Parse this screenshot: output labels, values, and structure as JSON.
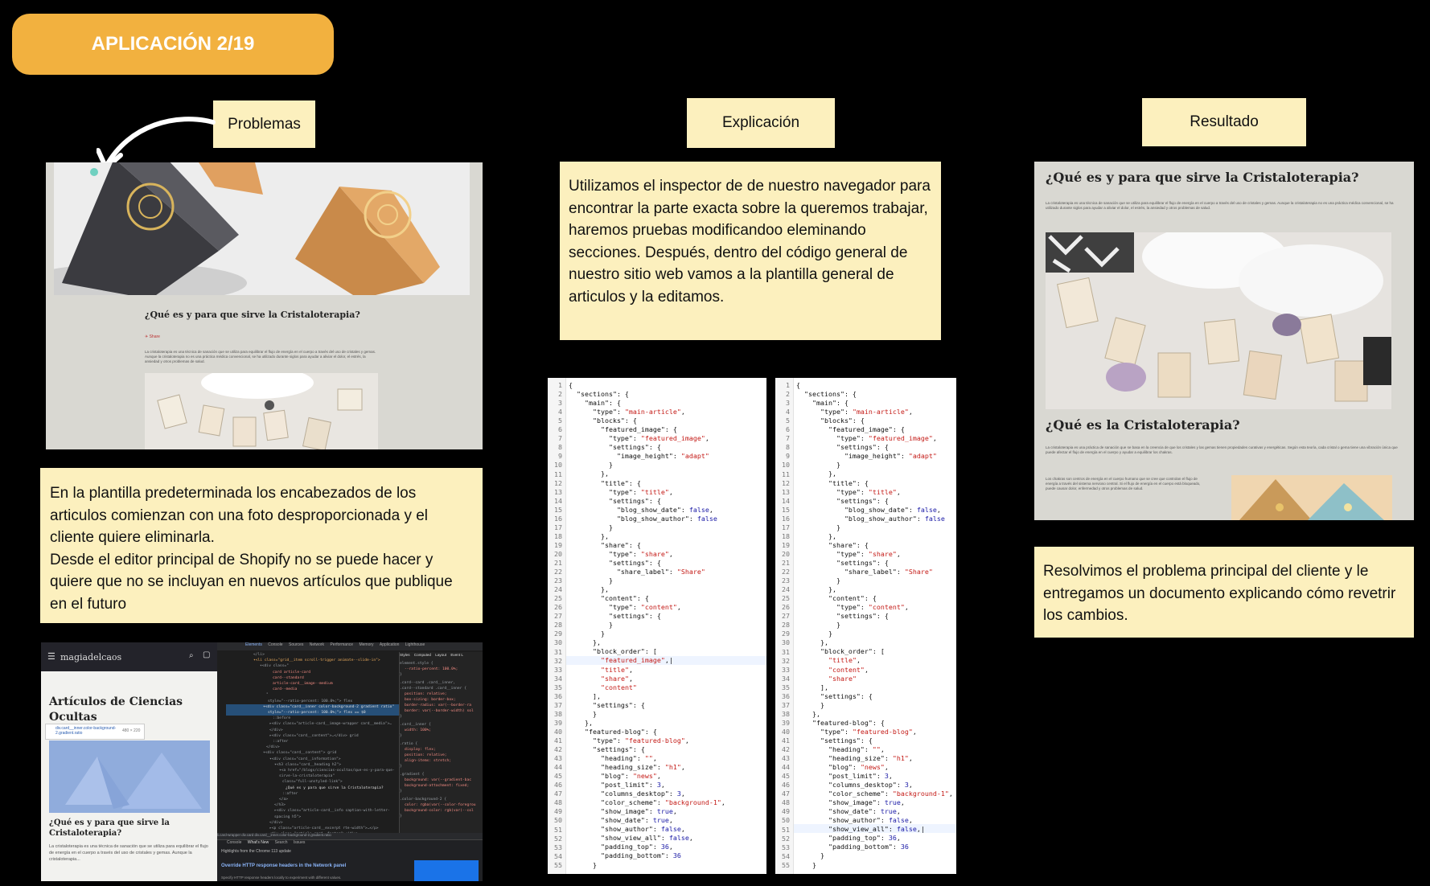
{
  "header": {
    "title": "APLICACIÓN 2/19"
  },
  "labels": {
    "problems": "Problemas",
    "explanation": "Explicación",
    "result": "Resultado"
  },
  "problem_text": "En la plantilla predeterminada los encabezados de los articulos comienzan con una foto desproporcionada y el cliente quiere eliminarla.\nDesde el editor principal de Shopify no se puede hacer y quiere que no se incluyan en nuevos artículos que publique en el futuro",
  "explanation_text": "Utilizamos el inspector de de nuestro navegador para encontrar la parte exacta sobre la queremos trabajar, haremos pruebas modificandoo eleminando secciones. Después, dentro del código general de nuestro sitio  web vamos a la plantilla general  de articulos y la editamos.",
  "result_text": "Resolvimos el problema principal del cliente y le entregamos un documento explicando cómo revetrir los cambios.",
  "before_screenshot": {
    "title": "¿Qué es y para que sirve la Cristaloterapia?",
    "share": "Share",
    "body": "La cristaloterapia es una técnica de sanación que se utiliza para equilibrar el flujo de energía en el cuerpo a través del uso de cristales y gemas. Aunque la cristaloterapia no es una práctica médica convencional, se ha utilizado durante siglos para ayudar a aliviar el dolor, el estrés, la ansiedad y otros problemas de salud."
  },
  "result_screenshot": {
    "title": "¿Qué es y para que sirve la Cristaloterapia?",
    "intro": "La cristaloterapia es una técnica de sanación que se utiliza para equilibrar el flujo de energía en el cuerpo a través del uso de cristales y gemas. Aunque la cristaloterapia no es una práctica médica convencional, se ha utilizado durante siglos para ayudar a aliviar el dolor, el estrés, la ansiedad y otros problemas de salud.",
    "heading2": "¿Qué es la Cristaloterapia?",
    "para2": "La cristaloterapia es una práctica de sanación que se basa en la creencia de que los cristales y las gemas tienen propiedades curativas y energéticas. Según esta teoría, cada cristal o gema tiene una vibración única que puede afectar el flujo de energía en el cuerpo y ayudar a equilibrar los chakras.",
    "para3": "Los chakras son centros de energía en el cuerpo humano que se cree que controlan el flujo de energía a través del sistema nervioso central. Si el flujo de energía en el cuerpo está bloqueado, puede causar dolor, enfermedad y otros problemas de salud."
  },
  "devtools": {
    "site": "magiadelcaos",
    "heading": "Artículos de Ciencias Ocultas",
    "tooltip": "div.card__inner.color-background-2.gradient.ratio",
    "tooltip_size": "480 × 220",
    "article_title": "¿Qué es y para que sirve la Cristaloterapia?",
    "article_body": "La cristaloterapia es una técnica de sanación que se utiliza para equilibrar el flujo de energía en el cuerpo a través del uso de cristales y gemas. Aunque la cristaloterapia...",
    "tabs": [
      "Elements",
      "Console",
      "Sources",
      "Network",
      "Performance",
      "Memory",
      "Application",
      "Lighthouse"
    ],
    "styles_tabs": [
      "Styles",
      "Computed",
      "Layout",
      "Event L"
    ],
    "drawer_tabs": [
      "Console",
      "What's New",
      "Search",
      "Issues"
    ],
    "whats_new": "Highlights from the Chrome 113 update",
    "override": "Override HTTP response headers in the Network panel",
    "override_desc": "Specify HTTP response headers locally to experiment with different values.",
    "breadcrumb": "li.card-wrapper  div.card  div.card__inner.color-background-2.gradient.ratio"
  },
  "code_before_line_count": 55,
  "code_after_line_count": 55
}
